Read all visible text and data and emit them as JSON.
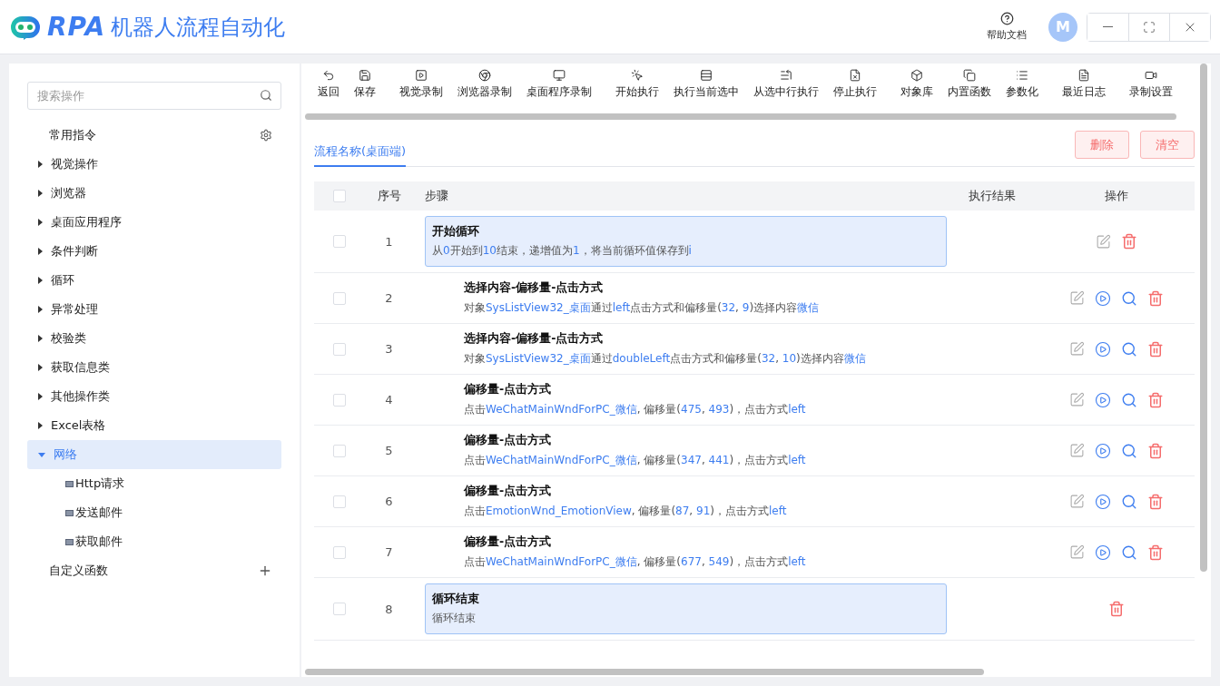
{
  "app": {
    "logo_text": "RPA",
    "title": "机器人流程自动化",
    "help": "帮助文档",
    "avatar": "M"
  },
  "sidebar": {
    "search": {
      "placeholder": "搜索操作"
    },
    "items": [
      {
        "label": "常用指令",
        "kind": "settings",
        "selected": false
      },
      {
        "label": "视觉操作",
        "kind": "group",
        "expanded": false,
        "selected": false
      },
      {
        "label": "浏览器",
        "kind": "group",
        "expanded": false,
        "selected": false
      },
      {
        "label": "桌面应用程序",
        "kind": "group",
        "expanded": false,
        "selected": false
      },
      {
        "label": "条件判断",
        "kind": "group",
        "expanded": false,
        "selected": false
      },
      {
        "label": "循环",
        "kind": "group",
        "expanded": false,
        "selected": false
      },
      {
        "label": "异常处理",
        "kind": "group",
        "expanded": false,
        "selected": false
      },
      {
        "label": "校验类",
        "kind": "group",
        "expanded": false,
        "selected": false
      },
      {
        "label": "获取信息类",
        "kind": "group",
        "expanded": false,
        "selected": false
      },
      {
        "label": "其他操作类",
        "kind": "group",
        "expanded": false,
        "selected": false
      },
      {
        "label": "Excel表格",
        "kind": "group",
        "expanded": false,
        "selected": false
      },
      {
        "label": "网络",
        "kind": "group",
        "expanded": true,
        "selected": true,
        "children": [
          {
            "label": "Http请求"
          },
          {
            "label": "发送邮件"
          },
          {
            "label": "获取邮件"
          }
        ]
      },
      {
        "label": "自定义函数",
        "kind": "add",
        "selected": false
      }
    ]
  },
  "toolbar": [
    {
      "label": "返回"
    },
    {
      "label": "保存"
    },
    {
      "label": "视觉录制"
    },
    {
      "label": "浏览器录制"
    },
    {
      "label": "桌面程序录制"
    },
    {
      "label": "开始执行"
    },
    {
      "label": "执行当前选中"
    },
    {
      "label": "从选中行执行"
    },
    {
      "label": "停止执行"
    },
    {
      "label": "对象库"
    },
    {
      "label": "内置函数"
    },
    {
      "label": "参数化"
    },
    {
      "label": "最近日志"
    },
    {
      "label": "录制设置"
    }
  ],
  "tabs": [
    {
      "label": "流程名称(桌面端)",
      "selected": true
    }
  ],
  "actions": [
    "删除",
    "清空"
  ],
  "table": {
    "header_checked": false,
    "columns": [
      "序号",
      "步骤",
      "执行结果",
      "操作"
    ],
    "rows": [
      {
        "no": "1",
        "kind": "loop",
        "checked": false,
        "title": "开始循环",
        "desc": [
          {
            "t": "从",
            "hl": false
          },
          {
            "t": "0",
            "hl": true
          },
          {
            "t": "开始到",
            "hl": false
          },
          {
            "t": "10",
            "hl": true
          },
          {
            "t": "结束，递增值为",
            "hl": false
          },
          {
            "t": "1",
            "hl": true
          },
          {
            "t": "，将当前循环值保存到",
            "hl": false
          },
          {
            "t": "i",
            "hl": true
          }
        ]
      },
      {
        "no": "2",
        "kind": "action",
        "checked": false,
        "title": "选择内容-偏移量-点击方式",
        "desc": [
          {
            "t": "对象",
            "hl": false
          },
          {
            "t": "SysListView32_桌面",
            "hl": true
          },
          {
            "t": "通过",
            "hl": false
          },
          {
            "t": "left",
            "hl": true
          },
          {
            "t": "点击方式和偏移量(",
            "hl": false
          },
          {
            "t": "32",
            "hl": true
          },
          {
            "t": ", ",
            "hl": false
          },
          {
            "t": "9",
            "hl": true
          },
          {
            "t": ")选择内容",
            "hl": false
          },
          {
            "t": "微信",
            "hl": true
          }
        ]
      },
      {
        "no": "3",
        "kind": "action",
        "checked": false,
        "title": "选择内容-偏移量-点击方式",
        "desc": [
          {
            "t": "对象",
            "hl": false
          },
          {
            "t": "SysListView32_桌面",
            "hl": true
          },
          {
            "t": "通过",
            "hl": false
          },
          {
            "t": "doubleLeft",
            "hl": true
          },
          {
            "t": "点击方式和偏移量(",
            "hl": false
          },
          {
            "t": "32",
            "hl": true
          },
          {
            "t": ", ",
            "hl": false
          },
          {
            "t": "10",
            "hl": true
          },
          {
            "t": ")选择内容",
            "hl": false
          },
          {
            "t": "微信",
            "hl": true
          }
        ]
      },
      {
        "no": "4",
        "kind": "action",
        "checked": false,
        "title": "偏移量-点击方式",
        "desc": [
          {
            "t": "点击",
            "hl": false
          },
          {
            "t": "WeChatMainWndForPC_微信",
            "hl": true
          },
          {
            "t": ", 偏移量(",
            "hl": false
          },
          {
            "t": "475",
            "hl": true
          },
          {
            "t": ", ",
            "hl": false
          },
          {
            "t": "493",
            "hl": true
          },
          {
            "t": ")，点击方式",
            "hl": false
          },
          {
            "t": "left",
            "hl": true
          }
        ]
      },
      {
        "no": "5",
        "kind": "action",
        "checked": false,
        "title": "偏移量-点击方式",
        "desc": [
          {
            "t": "点击",
            "hl": false
          },
          {
            "t": "WeChatMainWndForPC_微信",
            "hl": true
          },
          {
            "t": ", 偏移量(",
            "hl": false
          },
          {
            "t": "347",
            "hl": true
          },
          {
            "t": ", ",
            "hl": false
          },
          {
            "t": "441",
            "hl": true
          },
          {
            "t": ")，点击方式",
            "hl": false
          },
          {
            "t": "left",
            "hl": true
          }
        ]
      },
      {
        "no": "6",
        "kind": "action",
        "checked": false,
        "title": "偏移量-点击方式",
        "desc": [
          {
            "t": "点击",
            "hl": false
          },
          {
            "t": "EmotionWnd_EmotionView",
            "hl": true
          },
          {
            "t": ", 偏移量(",
            "hl": false
          },
          {
            "t": "87",
            "hl": true
          },
          {
            "t": ", ",
            "hl": false
          },
          {
            "t": "91",
            "hl": true
          },
          {
            "t": ")，点击方式",
            "hl": false
          },
          {
            "t": "left",
            "hl": true
          }
        ]
      },
      {
        "no": "7",
        "kind": "action",
        "checked": false,
        "title": "偏移量-点击方式",
        "desc": [
          {
            "t": "点击",
            "hl": false
          },
          {
            "t": "WeChatMainWndForPC_微信",
            "hl": true
          },
          {
            "t": ", 偏移量(",
            "hl": false
          },
          {
            "t": "677",
            "hl": true
          },
          {
            "t": ", ",
            "hl": false
          },
          {
            "t": "549",
            "hl": true
          },
          {
            "t": ")，点击方式",
            "hl": false
          },
          {
            "t": "left",
            "hl": true
          }
        ]
      },
      {
        "no": "8",
        "kind": "loop-end",
        "checked": false,
        "title": "循环结束",
        "desc": [
          {
            "t": "循环结束",
            "hl": false
          }
        ]
      }
    ]
  }
}
